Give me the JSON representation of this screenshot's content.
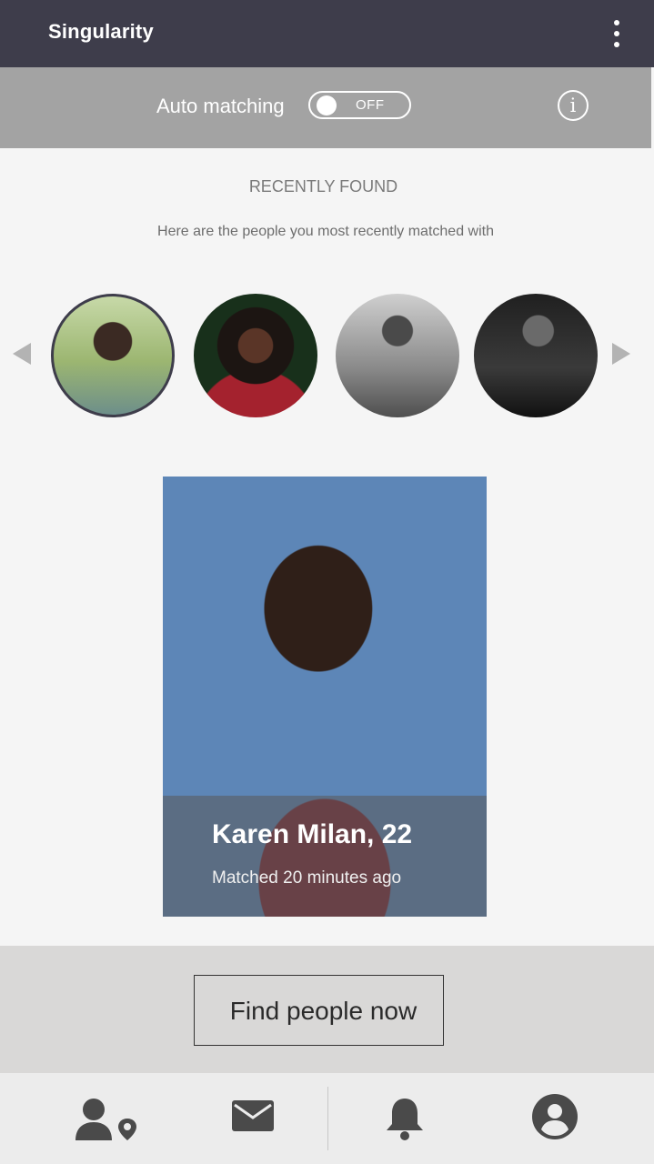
{
  "app": {
    "title": "Singularity"
  },
  "automatch": {
    "label": "Auto matching",
    "toggle_state": "OFF"
  },
  "recent": {
    "title": "RECENTLY FOUND",
    "subtitle": "Here are the people you most recently matched with"
  },
  "profile": {
    "name_age": "Karen Milan, 22",
    "matched": "Matched 20 minutes ago"
  },
  "actions": {
    "find_label": "Find people now"
  },
  "nav": {
    "items": [
      "people-nearby",
      "messages",
      "notifications",
      "profile"
    ]
  },
  "colors": {
    "appbar": "#3e3d4b",
    "automatch_bar": "#a3a3a3",
    "find_panel": "#d9d8d7",
    "nav_icon": "#4a4a4a"
  }
}
